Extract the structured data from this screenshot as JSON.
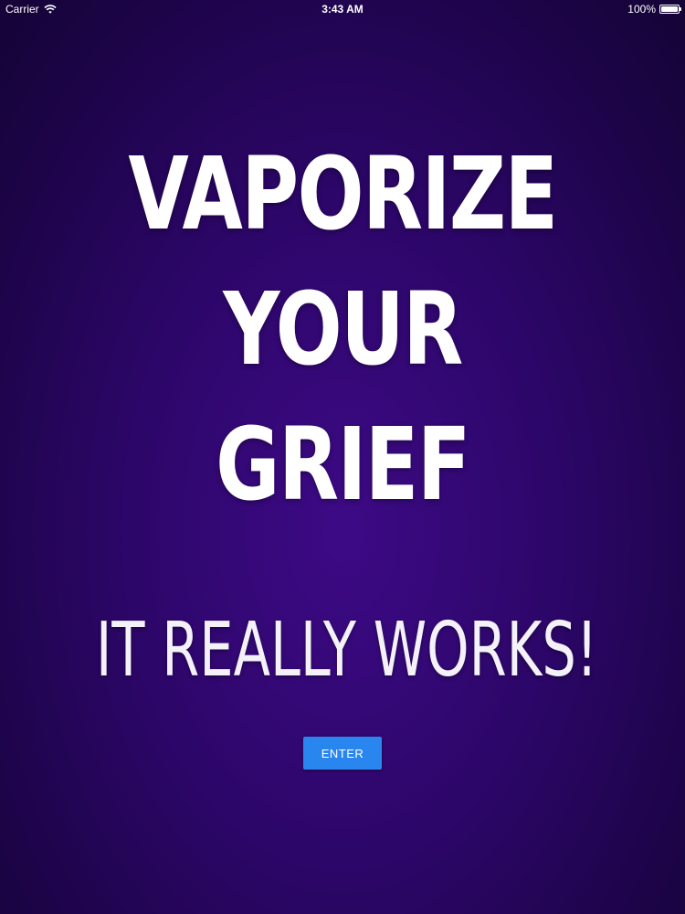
{
  "status_bar": {
    "carrier": "Carrier",
    "time": "3:43 AM",
    "battery_percent": "100%",
    "battery_level": 1.0,
    "icons": [
      "wifi-icon",
      "battery-icon"
    ]
  },
  "headline": {
    "lines": [
      "VAPORIZE",
      "YOUR",
      "GRIEF"
    ]
  },
  "tagline": "IT REALLY WORKS!",
  "enter_button": {
    "label": "ENTER"
  },
  "colors": {
    "background_center": "#3d0a86",
    "background_edge": "#150336",
    "text": "#ffffff",
    "button": "#2a86ef"
  }
}
